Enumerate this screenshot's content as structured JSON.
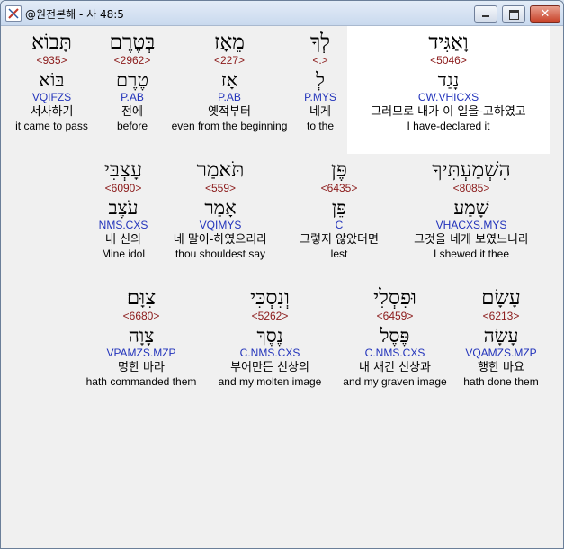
{
  "window": {
    "title": "@원전본해 - 사 48:5"
  },
  "rows": [
    {
      "words": [
        {
          "heb": "וָאַגִּיד",
          "strong": "<5046>",
          "root": "נָגַד",
          "parse": "CW.VHICXS",
          "korean": "그러므로 내가 이 일을-고하였고",
          "english": "I have-declared it"
        },
        {
          "heb": "לְךָ",
          "strong": "<.>",
          "root": "לְ",
          "parse": "P.MYS",
          "korean": "네게",
          "english": "to the"
        },
        {
          "heb": "מֵאָז",
          "strong": "<227>",
          "root": "אָז",
          "parse": "P.AB",
          "korean": "옛적부터",
          "english": "even from the beginning"
        },
        {
          "heb": "בְּטֶרֶם",
          "strong": "<2962>",
          "root": "טֶרֶם",
          "parse": "P.AB",
          "korean": "전에",
          "english": "before"
        },
        {
          "heb": "תָּבוֹא",
          "strong": "<935>",
          "root": "בּוֹא",
          "parse": "VQIFZS",
          "korean": "서사하기",
          "english": "it came to pass"
        }
      ]
    },
    {
      "words": [
        {
          "heb": "הִשְׁמַעְתִּיךָ",
          "strong": "<8085>",
          "root": "שָׁמַע",
          "parse": "VHACXS.MYS",
          "korean": "그것을 네게 보였느니라",
          "english": "I shewed it thee"
        },
        {
          "heb": "פֶּן",
          "strong": "<6435>",
          "root": "פֵּן",
          "parse": "C",
          "korean": "그렇지 않았더면",
          "english": "lest"
        },
        {
          "heb": "תֹּאמַר",
          "strong": "<559>",
          "root": "אָמַר",
          "parse": "VQIMYS",
          "korean": "네 말이-하였으리라",
          "english": "thou shouldest say"
        },
        {
          "heb": "עָצְבִּי",
          "strong": "<6090>",
          "root": "עֹצֶב",
          "parse": "NMS.CXS",
          "korean": "내 신의",
          "english": "Mine idol"
        }
      ]
    },
    {
      "words": [
        {
          "heb": "עָשָׂם",
          "strong": "<6213>",
          "root": "עָשָׂה",
          "parse": "VQAMZS.MZP",
          "korean": "행한 바요",
          "english": "hath done them"
        },
        {
          "heb": "וּפִסְלִי",
          "strong": "<6459>",
          "root": "פֶּסֶל",
          "parse": "C.NMS.CXS",
          "korean": "내 새긴 신상과",
          "english": "and my graven image"
        },
        {
          "heb": "וְנִסְכִּי",
          "strong": "<5262>",
          "root": "נֶסֶךְ",
          "parse": "C.NMS.CXS",
          "korean": "부어만든 신상의",
          "english": "and my molten image"
        },
        {
          "heb": "צִוָּם׃",
          "strong": "<6680>",
          "root": "צָוָה",
          "parse": "VPAMZS.MZP",
          "korean": "명한 바라",
          "english": "hath commanded them"
        }
      ]
    }
  ]
}
